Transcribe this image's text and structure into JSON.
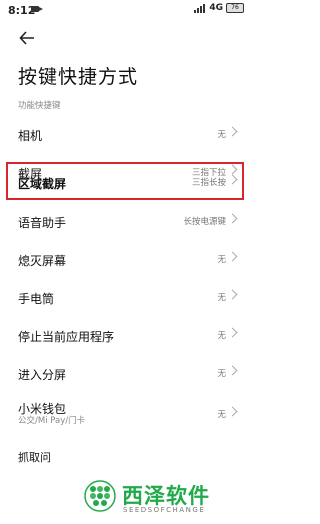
{
  "status_bar": {
    "time": "8:12",
    "network": "4G",
    "battery": "76"
  },
  "header": {
    "title": "按键快捷方式"
  },
  "section": {
    "label": "功能快捷键"
  },
  "items": [
    {
      "label": "相机",
      "value": "无"
    },
    {
      "label": "截屏",
      "value": "三指下拉"
    },
    {
      "label": "区域截屏",
      "value": "三指长按"
    },
    {
      "label": "语音助手",
      "value": "长按电源键"
    },
    {
      "label": "熄灭屏幕",
      "value": "无"
    },
    {
      "label": "手电筒",
      "value": "无"
    },
    {
      "label": "停止当前应用程序",
      "value": "无"
    },
    {
      "label": "进入分屏",
      "value": "无"
    },
    {
      "label": "小米钱包",
      "sub": "公交/Mi Pay/门卡",
      "value": "无"
    },
    {
      "label": "抓取问"
    }
  ],
  "watermark": {
    "title": "西泽软件",
    "subtitle": "SEEDSOFCHANGE"
  },
  "colors": {
    "highlight": "#d9262c",
    "watermark": "#20aa4a"
  }
}
